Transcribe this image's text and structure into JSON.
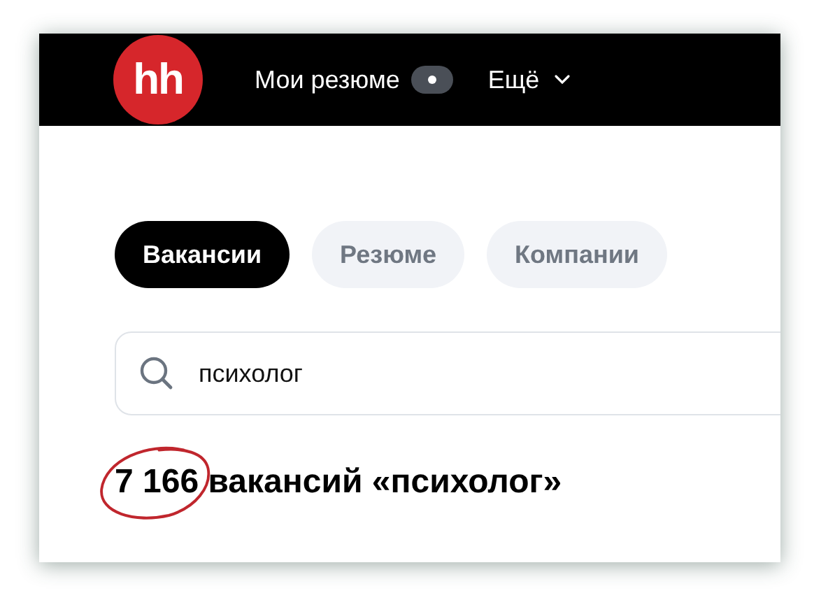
{
  "header": {
    "logo": "hh",
    "nav": [
      {
        "kind": "badge",
        "label": "Мои резюме"
      },
      {
        "kind": "dropdown",
        "label": "Ещё"
      }
    ]
  },
  "tabs": [
    {
      "label": "Вакансии",
      "selected": true
    },
    {
      "label": "Резюме",
      "selected": false
    },
    {
      "label": "Компании",
      "selected": false
    }
  ],
  "search": {
    "value": "психолог"
  },
  "results_heading": "7 166 вакансий «психолог»"
}
